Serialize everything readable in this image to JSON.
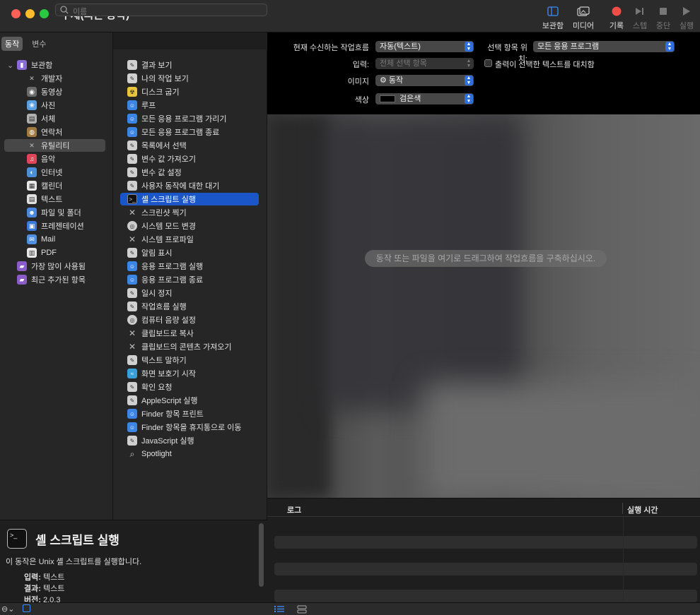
{
  "window": {
    "title": "무제(빠른 동작)"
  },
  "toolbar": {
    "library": "보관함",
    "media": "미디어",
    "record": "기록",
    "step": "스텝",
    "stop": "중단",
    "run": "실행"
  },
  "library_pane": {
    "tab_actions": "동작",
    "tab_variables": "변수",
    "search_placeholder": "이름",
    "root": "보관함",
    "categories": [
      "개발자",
      "동영상",
      "사진",
      "서체",
      "연락처",
      "유틸리티",
      "음악",
      "인터넷",
      "캘린더",
      "텍스트",
      "파일 및 폴더",
      "프레젠테이션",
      "Mail",
      "PDF"
    ],
    "smart_groups": [
      "가장 많이 사용됨",
      "최근 추가된 항목"
    ],
    "selected_category": "유틸리티"
  },
  "actions": [
    "결과 보기",
    "나의 작업 보기",
    "디스크 굽기",
    "루프",
    "모든 응용 프로그램 가리기",
    "모든 응용 프로그램 종료",
    "목록에서 선택",
    "변수 값 가져오기",
    "변수 값 설정",
    "사용자 동작에 대한 대기",
    "셸 스크립트 실행",
    "스크린샷 찍기",
    "시스템 모드 변경",
    "시스템 프로파일",
    "알림 표시",
    "응용 프로그램 실행",
    "응용 프로그램 종료",
    "일시 정지",
    "작업흐름 실행",
    "컴퓨터 음량 설정",
    "클립보드로 복사",
    "클립보드의 콘텐츠 가져오기",
    "텍스트 말하기",
    "화면 보호기 시작",
    "확인 요청",
    "AppleScript 실행",
    "Finder 항목 프린트",
    "Finder 항목을 휴지통으로 이동",
    "JavaScript 실행",
    "Spotlight"
  ],
  "selected_action": "셸 스크립트 실행",
  "config": {
    "receives_label": "현재 수신하는 작업흐름",
    "receives_value": "자동(텍스트)",
    "location_label": "선택 항목 위치:",
    "location_value": "모든 응용 프로그램",
    "input_label": "입력:",
    "input_value": "전체 선택 항목",
    "replace_label": "출력이 선택한 텍스트를 대치함",
    "image_label": "이미지",
    "image_value": "동작",
    "color_label": "색상",
    "color_value": "검은색"
  },
  "workflow": {
    "hint": "동작 또는 파일을 여기로 드래그하여 작업흐름을 구축하십시오."
  },
  "log": {
    "col_log": "로그",
    "col_time": "실행 시간"
  },
  "description": {
    "title": "셸 스크립트 실행",
    "text": "이 동작은 Unix 셸 스크립트를 실행합니다.",
    "input_label": "입력:",
    "input_value": "텍스트",
    "result_label": "결과:",
    "result_value": "텍스트",
    "version_label": "버전:",
    "version_value": "2.0.3"
  }
}
